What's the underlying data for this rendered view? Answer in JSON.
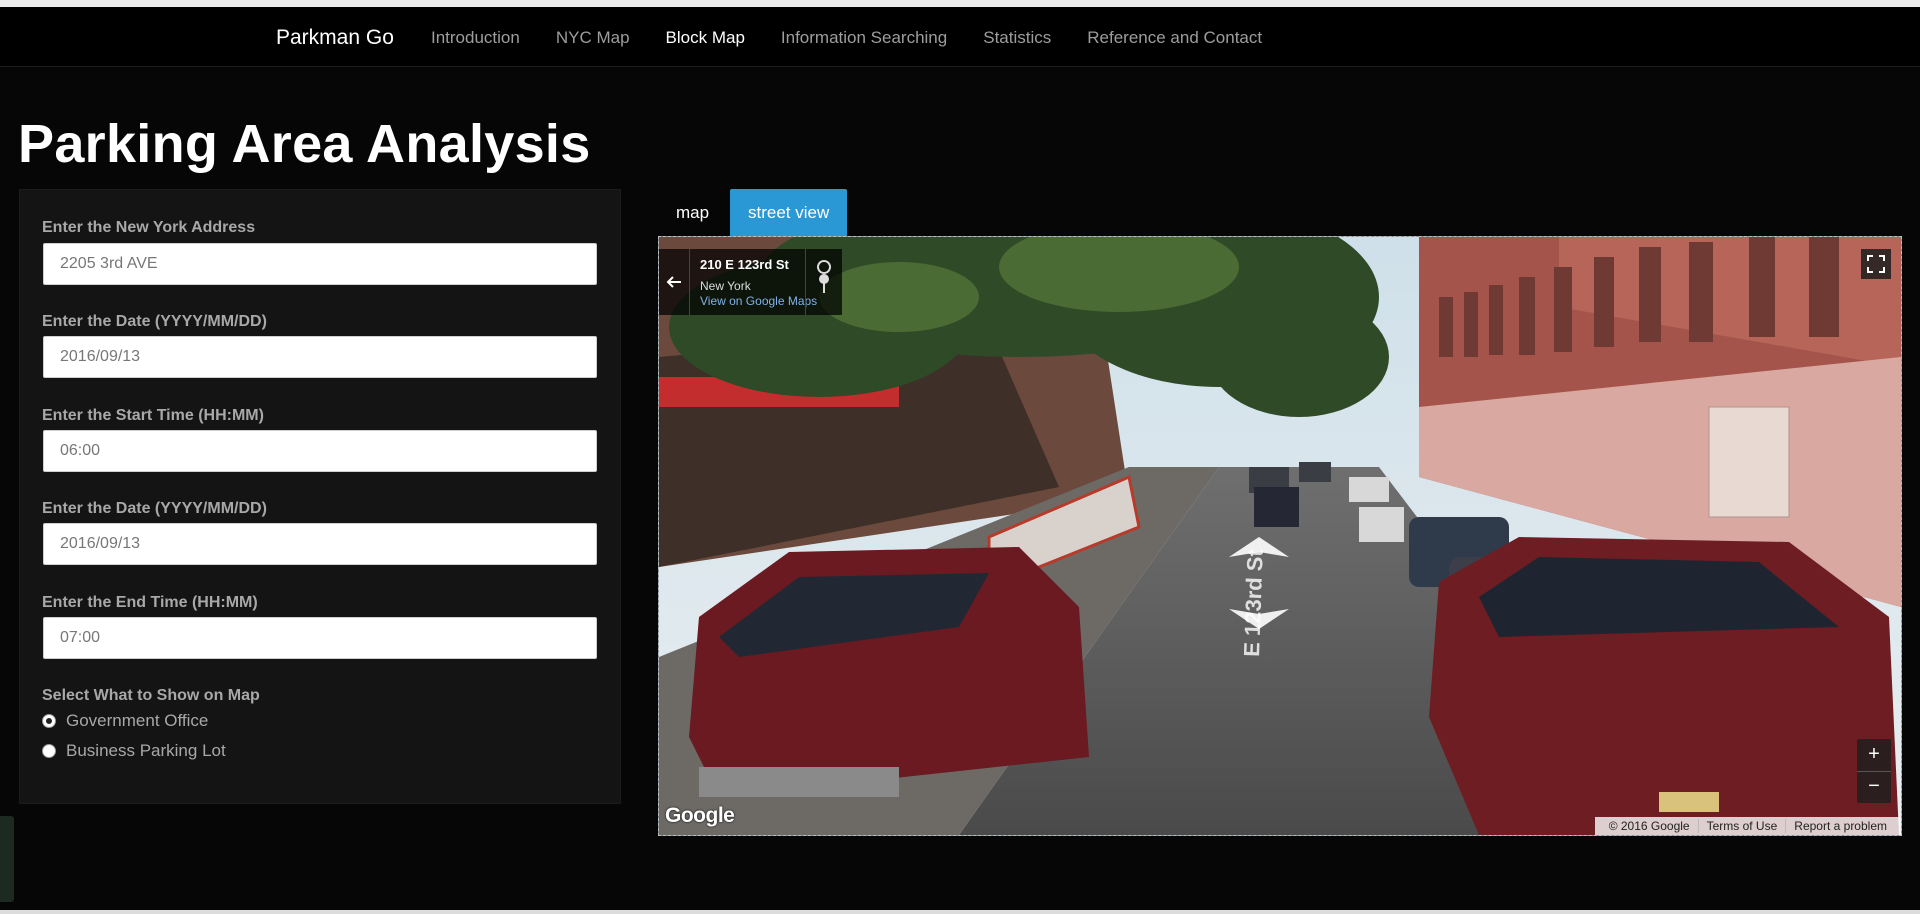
{
  "nav": {
    "brand": "Parkman Go",
    "items": [
      "Introduction",
      "NYC Map",
      "Block Map",
      "Information Searching",
      "Statistics",
      "Reference and Contact"
    ],
    "active": "Block Map"
  },
  "page": {
    "title": "Parking Area Analysis"
  },
  "form": {
    "address_label": "Enter the New York Address",
    "address_value": "2205 3rd AVE",
    "start_date_label": "Enter the Date (YYYY/MM/DD)",
    "start_date_value": "2016/09/13",
    "start_time_label": "Enter the Start Time (HH:MM)",
    "start_time_value": "06:00",
    "end_date_label": "Enter the Date (YYYY/MM/DD)",
    "end_date_value": "2016/09/13",
    "end_time_label": "Enter the End Time (HH:MM)",
    "end_time_value": "07:00",
    "show_label": "Select What to Show on Map",
    "options": [
      "Government Office",
      "Business Parking Lot"
    ],
    "selected": "Government Office"
  },
  "tabs": {
    "map": "map",
    "street_view": "street view",
    "active": "street view"
  },
  "streetview": {
    "street": "210 E 123rd St",
    "city": "New York",
    "link": "View on Google Maps",
    "google": "Google",
    "copyright": "© 2016 Google",
    "terms": "Terms of Use",
    "report": "Report a problem",
    "zoom_in": "+",
    "zoom_out": "−"
  },
  "colors": {
    "accent": "#2b98d6",
    "background": "#060606",
    "panel": "#141414"
  }
}
